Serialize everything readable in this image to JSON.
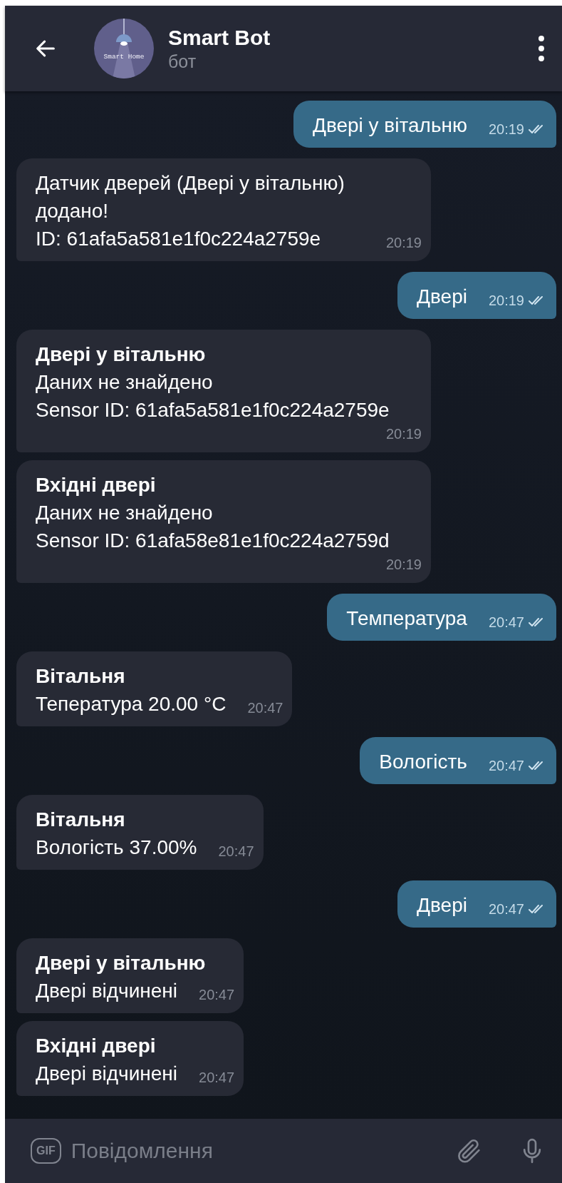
{
  "header": {
    "title": "Smart Bot",
    "subtitle": "бот",
    "avatar_text": "Smart Home"
  },
  "messages": [
    {
      "kind": "outgoing",
      "lines": [
        "Двері у вітальню"
      ],
      "time": "20:19",
      "read": true
    },
    {
      "kind": "incoming",
      "lines": [
        "Датчик дверей (Двері у вітальню) додано!",
        "ID: 61afa5a581e1f0c224a2759e"
      ],
      "time": "20:19"
    },
    {
      "kind": "outgoing",
      "lines": [
        "Двері"
      ],
      "time": "20:19",
      "read": true
    },
    {
      "kind": "incoming",
      "title": "Двері у вітальню",
      "lines": [
        "Даних не знайдено",
        "Sensor ID: 61afa5a581e1f0c224a2759e"
      ],
      "time": "20:19"
    },
    {
      "kind": "incoming",
      "title": "Вхідні двері",
      "lines": [
        "Даних не знайдено",
        "Sensor ID: 61afa58e81e1f0c224a2759d"
      ],
      "time": "20:19"
    },
    {
      "kind": "outgoing",
      "lines": [
        "Температура"
      ],
      "time": "20:47",
      "read": true
    },
    {
      "kind": "incoming",
      "title": "Вітальня",
      "lines": [
        "Тепература 20.00 °C"
      ],
      "time": "20:47"
    },
    {
      "kind": "outgoing",
      "lines": [
        "Вологість"
      ],
      "time": "20:47",
      "read": true
    },
    {
      "kind": "incoming",
      "title": "Вітальня",
      "lines": [
        "Вологість 37.00%"
      ],
      "time": "20:47"
    },
    {
      "kind": "outgoing",
      "lines": [
        "Двері"
      ],
      "time": "20:47",
      "read": true
    },
    {
      "kind": "incoming",
      "title": "Двері у вітальню",
      "lines": [
        "Двері відчинені"
      ],
      "time": "20:47"
    },
    {
      "kind": "incoming",
      "title": "Вхідні двері",
      "lines": [
        "Двері відчинені"
      ],
      "time": "20:47"
    }
  ],
  "composer": {
    "gif_label": "GIF",
    "placeholder": "Повідомлення"
  }
}
